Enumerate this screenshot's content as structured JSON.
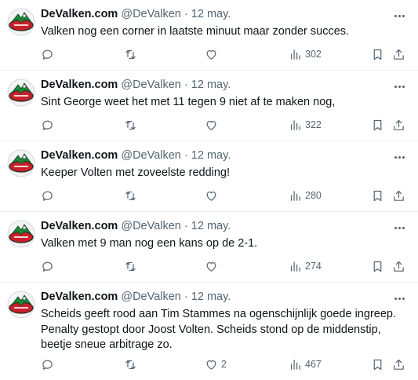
{
  "account": {
    "name": "DeValken.com",
    "handle": "@DeValken"
  },
  "tweets": [
    {
      "date": "12 may.",
      "text": "Valken nog een corner in laatste minuut maar zonder succes.",
      "likes": "",
      "views": "302"
    },
    {
      "date": "12 may.",
      "text": "Sint George weet het met 11 tegen 9 niet af te maken nog,",
      "likes": "",
      "views": "322"
    },
    {
      "date": "12 may.",
      "text": "Keeper Volten met zoveelste redding!",
      "likes": "",
      "views": "280"
    },
    {
      "date": "12 may.",
      "text": "Valken met 9 man nog een kans op de 2-1.",
      "likes": "",
      "views": "274"
    },
    {
      "date": "12 may.",
      "text": "Scheids geeft rood aan Tim Stammes na ogenschijnlijk goede ingreep. Penalty gestopt door Joost Volten. Scheids stond op de middenstip, beetje sneue arbitrage zo.",
      "likes": "2",
      "views": "467"
    }
  ],
  "separator": "·",
  "icons": {
    "reply": "reply-icon",
    "retweet": "retweet-icon",
    "like": "heart-icon",
    "views": "views-icon",
    "bookmark": "bookmark-icon",
    "share": "share-icon",
    "more": "more-icon",
    "avatar": "team-logo"
  },
  "colors": {
    "text": "#0f1419",
    "secondary": "#536471",
    "border": "#eff3f4",
    "logo_green": "#1a8a3a",
    "logo_red": "#c8202b"
  }
}
